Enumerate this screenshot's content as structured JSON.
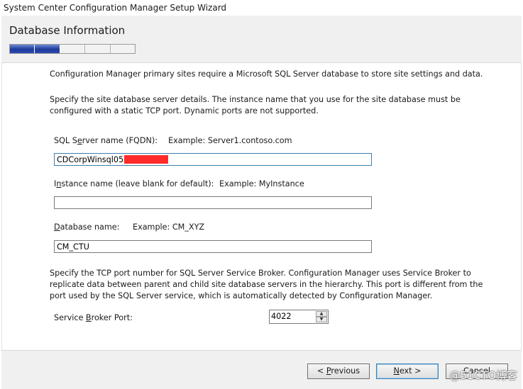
{
  "window": {
    "title": "System Center Configuration Manager Setup Wizard"
  },
  "header": {
    "title": "Database Information",
    "progress": {
      "total_steps": 5,
      "completed_steps": 2
    }
  },
  "content": {
    "intro": "Configuration Manager primary sites require a Microsoft SQL Server database to store site settings and data.",
    "instance_note": "Specify the site database server details. The instance name that you use for the site database must be configured with a static TCP port. Dynamic ports are not supported.",
    "sql_server": {
      "label_pre": "SQL S",
      "label_key": "e",
      "label_post": "rver name (FQDN):",
      "example": "Example: Server1.contoso.com",
      "value": "CDCorpWinsql05."
    },
    "instance": {
      "label_pre": "I",
      "label_key": "n",
      "label_post": "stance name (leave blank for default):",
      "example": "Example: MyInstance",
      "value": ""
    },
    "database": {
      "label_pre": "",
      "label_key": "D",
      "label_post": "atabase name:",
      "example": "Example: CM_XYZ",
      "value": "CM_CTU"
    },
    "broker_note": "Specify the TCP port number for SQL Server Service Broker. Configuration Manager uses Service Broker to replicate data between parent and child site database servers in the hierarchy. This port is different from the port used by the SQL Server service, which is automatically detected by Configuration Manager.",
    "broker_port": {
      "label_pre": "Service ",
      "label_key": "B",
      "label_post": "roker Port:",
      "value": "4022"
    }
  },
  "footer": {
    "previous": {
      "key": "P",
      "post": "revious"
    },
    "next": {
      "key": "N",
      "post": "ext >"
    },
    "cancel_label": "Cancel"
  },
  "watermark": "@51CTO博客",
  "colors": {
    "progress_fill": "#1e3a9a",
    "redaction": "#ff2b2b",
    "focus_border": "#3c7fb1"
  }
}
